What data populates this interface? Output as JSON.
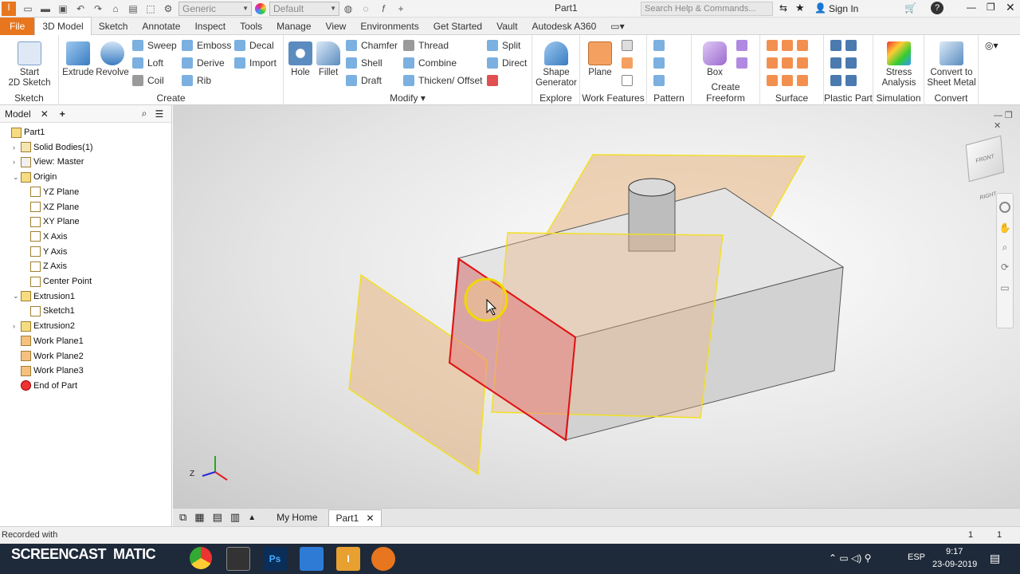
{
  "qat": {
    "material": "Generic",
    "appearance": "Default",
    "doc_title": "Part1",
    "search_placeholder": "Search Help & Commands...",
    "sign_in": "Sign In"
  },
  "tabs": [
    "File",
    "3D Model",
    "Sketch",
    "Annotate",
    "Inspect",
    "Tools",
    "Manage",
    "View",
    "Environments",
    "Get Started",
    "Vault",
    "Autodesk A360"
  ],
  "ribbon": {
    "sketch": {
      "start": "Start",
      "start2": "2D Sketch",
      "label": "Sketch"
    },
    "create": {
      "extrude": "Extrude",
      "revolve": "Revolve",
      "sweep": "Sweep",
      "loft": "Loft",
      "coil": "Coil",
      "emboss": "Emboss",
      "derive": "Derive",
      "rib": "Rib",
      "decal": "Decal",
      "import": "Import",
      "label": "Create"
    },
    "modify": {
      "hole": "Hole",
      "fillet": "Fillet",
      "chamfer": "Chamfer",
      "shell": "Shell",
      "draft": "Draft",
      "thread": "Thread",
      "combine": "Combine",
      "thicken": "Thicken/ Offset",
      "split": "Split",
      "direct": "Direct",
      "label": "Modify"
    },
    "explore": {
      "shape": "Shape",
      "shape2": "Generator",
      "label": "Explore"
    },
    "work": {
      "plane": "Plane",
      "label": "Work Features"
    },
    "pattern": {
      "label": "Pattern"
    },
    "freeform": {
      "box": "Box",
      "label": "Create Freeform"
    },
    "surface": {
      "label": "Surface"
    },
    "plastic": {
      "label": "Plastic Part"
    },
    "simulation": {
      "stress": "Stress",
      "stress2": "Analysis",
      "label": "Simulation"
    },
    "convert": {
      "conv": "Convert to",
      "conv2": "Sheet Metal",
      "label": "Convert"
    }
  },
  "browser": {
    "tab": "Model",
    "tree": [
      {
        "label": "Part1",
        "expand": ""
      },
      {
        "label": "Solid Bodies(1)",
        "expand": "›"
      },
      {
        "label": "View: Master",
        "expand": "›"
      },
      {
        "label": "Origin",
        "expand": "⌄"
      },
      {
        "label": "YZ Plane",
        "expand": ""
      },
      {
        "label": "XZ Plane",
        "expand": ""
      },
      {
        "label": "XY Plane",
        "expand": ""
      },
      {
        "label": "X Axis",
        "expand": ""
      },
      {
        "label": "Y Axis",
        "expand": ""
      },
      {
        "label": "Z Axis",
        "expand": ""
      },
      {
        "label": "Center Point",
        "expand": ""
      },
      {
        "label": "Extrusion1",
        "expand": "⌄"
      },
      {
        "label": "Sketch1",
        "expand": ""
      },
      {
        "label": "Extrusion2",
        "expand": "›"
      },
      {
        "label": "Work Plane1",
        "expand": ""
      },
      {
        "label": "Work Plane2",
        "expand": ""
      },
      {
        "label": "Work Plane3",
        "expand": ""
      },
      {
        "label": "End of Part",
        "expand": ""
      }
    ]
  },
  "viewcube": {
    "face1": "FRONT",
    "face2": "RIGHT"
  },
  "axes": {
    "z": "Z"
  },
  "doctabs": {
    "home": "My Home",
    "part": "Part1"
  },
  "status": {
    "recorded": "Recorded with",
    "page1": "1",
    "page2": "1"
  },
  "watermark": "SCREENCAST  MATIC",
  "taskbar": {
    "lang": "ESP",
    "time": "9:17",
    "date": "23-09-2019"
  }
}
